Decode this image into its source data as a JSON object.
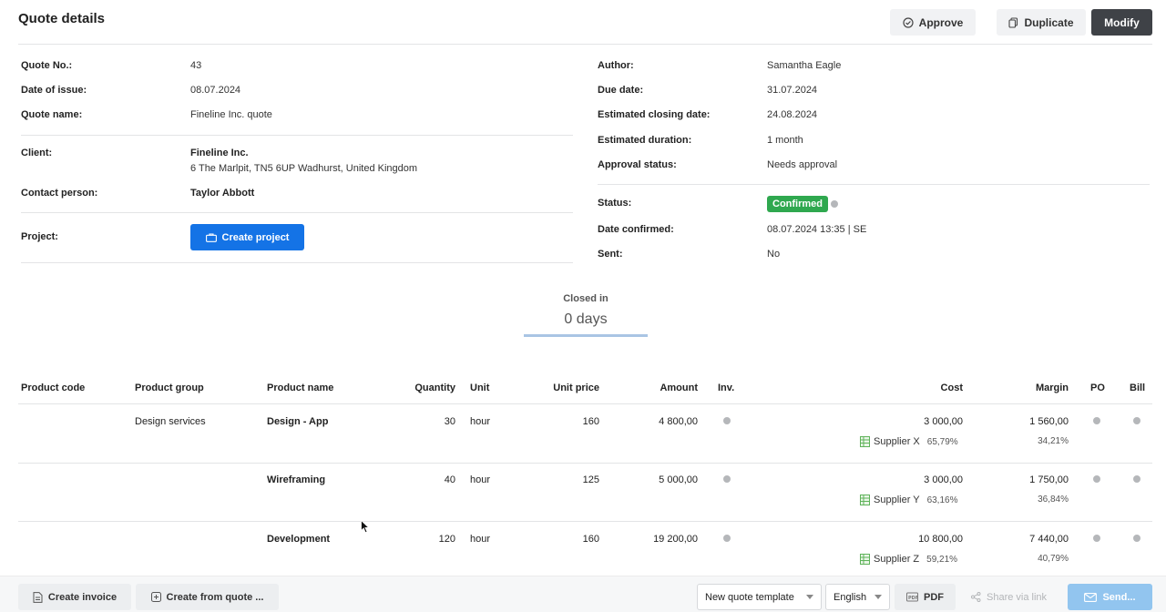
{
  "header": {
    "title": "Quote details",
    "approve_label": "Approve",
    "duplicate_label": "Duplicate",
    "modify_label": "Modify"
  },
  "details_left": {
    "quote_no_label": "Quote No.:",
    "quote_no": "43",
    "date_of_issue_label": "Date of issue:",
    "date_of_issue": "08.07.2024",
    "quote_name_label": "Quote name:",
    "quote_name": "Fineline Inc. quote",
    "client_label": "Client:",
    "client_name": "Fineline Inc.",
    "client_address": "6 The Marlpit, TN5 6UP Wadhurst, United Kingdom",
    "contact_label": "Contact person:",
    "contact": "Taylor Abbott",
    "project_label": "Project:",
    "create_project_label": "Create project"
  },
  "details_right": {
    "author_label": "Author:",
    "author": "Samantha Eagle",
    "due_date_label": "Due date:",
    "due_date": "31.07.2024",
    "closing_label": "Estimated closing date:",
    "closing": "24.08.2024",
    "duration_label": "Estimated duration:",
    "duration": "1 month",
    "approval_label": "Approval status:",
    "approval": "Needs approval",
    "status_label": "Status:",
    "status": "Confirmed",
    "status_color": "#2fa84f",
    "confirmed_label": "Date confirmed:",
    "confirmed": "08.07.2024 13:35 | SE",
    "sent_label": "Sent:",
    "sent": "No"
  },
  "closed": {
    "label": "Closed in",
    "value": "0 days"
  },
  "table": {
    "columns": {
      "code": "Product code",
      "group": "Product group",
      "name": "Product name",
      "qty": "Quantity",
      "unit": "Unit",
      "price": "Unit price",
      "amount": "Amount",
      "inv": "Inv.",
      "cost": "Cost",
      "margin": "Margin",
      "po": "PO",
      "bill": "Bill"
    },
    "rows": [
      {
        "code": "",
        "group": "Design services",
        "name": "Design - App",
        "qty": "30",
        "unit": "hour",
        "price": "160",
        "amount": "4 800,00",
        "cost": "3 000,00",
        "supplier": "Supplier X",
        "supplier_pct": "65,79%",
        "margin": "1 560,00",
        "margin_pct": "34,21%"
      },
      {
        "code": "",
        "group": "",
        "name": "Wireframing",
        "qty": "40",
        "unit": "hour",
        "price": "125",
        "amount": "5 000,00",
        "cost": "3 000,00",
        "supplier": "Supplier Y",
        "supplier_pct": "63,16%",
        "margin": "1 750,00",
        "margin_pct": "36,84%"
      },
      {
        "code": "",
        "group": "",
        "name": "Development",
        "qty": "120",
        "unit": "hour",
        "price": "160",
        "amount": "19 200,00",
        "cost": "10 800,00",
        "supplier": "Supplier Z",
        "supplier_pct": "59,21%",
        "margin": "7 440,00",
        "margin_pct": "40,79%"
      }
    ]
  },
  "footer": {
    "create_invoice": "Create invoice",
    "create_from_quote": "Create from quote ...",
    "template": "New quote template",
    "language": "English",
    "pdf": "PDF",
    "share": "Share via link",
    "send": "Send..."
  }
}
